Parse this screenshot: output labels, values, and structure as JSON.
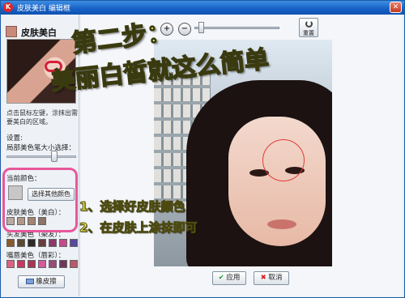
{
  "window": {
    "title": "皮肤美白 编辑框",
    "close_glyph": "✕",
    "app_icon_glyph": "K"
  },
  "left_panel": {
    "header": "皮肤美白",
    "instruction": "点击鼠标左键，涂抹出需要美白的区域。",
    "settings_label": "设置:",
    "brush_size_label": "局部美色笔大小选择：",
    "brush_size_level": 0.7,
    "current_color_label": "当前颜色：",
    "current_color": "#c8c6c6",
    "choose_other_color_button": "选择其他颜色",
    "skin_color_label": "皮肤美色（美白）：",
    "skin_swatches": [
      "#b9aaa0",
      "#b1978a",
      "#a48473",
      "#8c7468"
    ],
    "hair_color_label": "头发美色（染发）：",
    "hair_swatches": [
      "#8a5a2a",
      "#5b4a34",
      "#2e2a2a",
      "#6a3d3d",
      "#8a3a6a",
      "#c24b8c",
      "#5a4a9a"
    ],
    "lip_color_label": "嘴唇美色（唇彩）：",
    "lip_swatches": [
      "#e06080",
      "#c7375f",
      "#a23a56",
      "#d45a9a",
      "#9a4a7a",
      "#6a3a5a",
      "#b85a6a"
    ],
    "eraser_button": "橡皮擦"
  },
  "toolbar": {
    "zoom_in_glyph": "+",
    "zoom_out_glyph": "−",
    "zoom_level": 0.05,
    "reset_label": "重置"
  },
  "footer": {
    "ok_button": "应用",
    "ok_glyph": "✔",
    "cancel_button": "取消",
    "cancel_glyph": "✖"
  },
  "overlay": {
    "title_line1": "第二步：",
    "title_line2": "美丽白皙就这么简单",
    "note_1": "1、选择好皮肤颜色",
    "note_2": "2、在皮肤上涂抹即可",
    "highlight_color": "#e8579b",
    "caption_color": "#f7f24a"
  },
  "icons": [
    "app-icon",
    "close-icon",
    "zoom-in-icon",
    "zoom-out-icon",
    "reset-icon",
    "eraser-icon",
    "ok-icon",
    "cancel-icon",
    "skin-whitening-icon"
  ]
}
